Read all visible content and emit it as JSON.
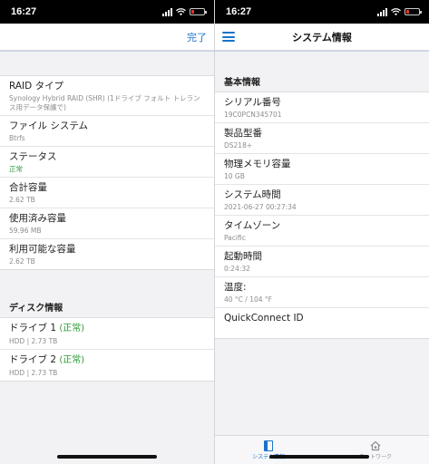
{
  "status_bar": {
    "time": "16:27"
  },
  "left": {
    "done_label": "完了",
    "storage_rows": [
      {
        "label": "RAID タイプ",
        "value": "Synology Hybrid RAID (SHR) (1ドライブ フォルト トレランス用データ保護で)"
      },
      {
        "label": "ファイル システム",
        "value": "Btrfs"
      },
      {
        "label": "ステータス",
        "value": "正常"
      },
      {
        "label": "合計容量",
        "value": "2.62 TB"
      },
      {
        "label": "使用済み容量",
        "value": "59.96 MB"
      },
      {
        "label": "利用可能な容量",
        "value": "2.62 TB"
      }
    ],
    "disk_section_title": "ディスク情報",
    "drives": [
      {
        "label": "ドライブ 1",
        "status": "(正常)",
        "value": "HDD | 2.73 TB"
      },
      {
        "label": "ドライブ 2",
        "status": "(正常)",
        "value": "HDD | 2.73 TB"
      }
    ]
  },
  "right": {
    "title": "システム情報",
    "section_title": "基本情報",
    "rows": [
      {
        "label": "シリアル番号",
        "value": "19C0PCN345701"
      },
      {
        "label": "製品型番",
        "value": "DS218+"
      },
      {
        "label": "物理メモリ容量",
        "value": "10 GB"
      },
      {
        "label": "システム時間",
        "value": "2021-06-27 00:27:34"
      },
      {
        "label": "タイムゾーン",
        "value": "Pacific"
      },
      {
        "label": "起動時間",
        "value": "0:24:32"
      },
      {
        "label": "温度:",
        "value": "40 °C / 104 °F"
      },
      {
        "label": "QuickConnect ID",
        "value": ""
      }
    ],
    "tabs": [
      {
        "label": "システム情報",
        "icon": "system-info-icon",
        "active": true
      },
      {
        "label": "ネットワーク",
        "icon": "network-icon",
        "active": false
      }
    ]
  },
  "colors": {
    "accent": "#1a73c9",
    "ok": "#2e9b3a",
    "battery_low": "#e0342b"
  }
}
